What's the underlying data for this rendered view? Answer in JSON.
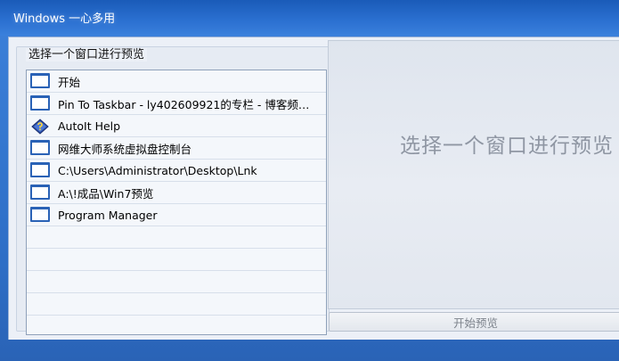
{
  "window": {
    "title": "Windows 一心多用"
  },
  "panel": {
    "label": "选择一个窗口进行预览"
  },
  "windows_list": [
    {
      "title": "开始",
      "icon": "window-icon"
    },
    {
      "title": "Pin To Taskbar - ly402609921的专栏 - 博客频道...",
      "icon": "window-icon"
    },
    {
      "title": "AutoIt Help",
      "icon": "help-book-icon"
    },
    {
      "title": "网维大师系统虚拟盘控制台",
      "icon": "window-icon"
    },
    {
      "title": "C:\\Users\\Administrator\\Desktop\\Lnk",
      "icon": "window-icon"
    },
    {
      "title": "A:\\!成品\\Win7预览",
      "icon": "window-icon"
    },
    {
      "title": "Program Manager",
      "icon": "window-icon"
    }
  ],
  "preview": {
    "placeholder": "选择一个窗口进行预览"
  },
  "buttons": {
    "start_preview": "开始预览"
  },
  "colors": {
    "titlebar": "#2a6fd0",
    "icon_frame": "#2a62b6"
  }
}
